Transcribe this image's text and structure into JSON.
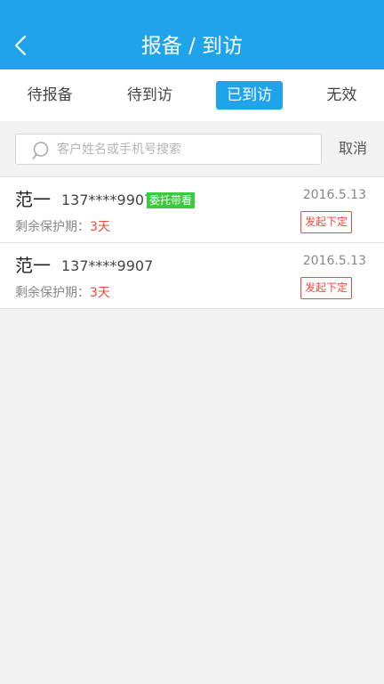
{
  "header": {
    "title": "报备 / 到访",
    "back_icon": "chevron-left-icon",
    "background": "#1fa3ea"
  },
  "tabs": [
    {
      "label": "待报备",
      "active": false
    },
    {
      "label": "待到访",
      "active": false
    },
    {
      "label": "已到访",
      "active": true
    },
    {
      "label": "无效",
      "active": false
    }
  ],
  "search": {
    "placeholder": "客户姓名或手机号搜索",
    "value": "",
    "icon": "search-icon",
    "cancel_label": "取消"
  },
  "customers": [
    {
      "name": "范一",
      "phone": "137****9907",
      "tag": "委托带看",
      "protect_label": "剩余保护期：",
      "protect_days": "3天",
      "date": "2016.5.13",
      "action_label": "发起下定"
    },
    {
      "name": "范一",
      "phone": "137****9907",
      "tag": "",
      "protect_label": "剩余保护期：",
      "protect_days": "3天",
      "date": "2016.5.13",
      "action_label": "发起下定"
    }
  ],
  "colors": {
    "accent": "#1fa3ea",
    "tag_green": "#3dc93d",
    "alert_red": "#f04a3a"
  }
}
